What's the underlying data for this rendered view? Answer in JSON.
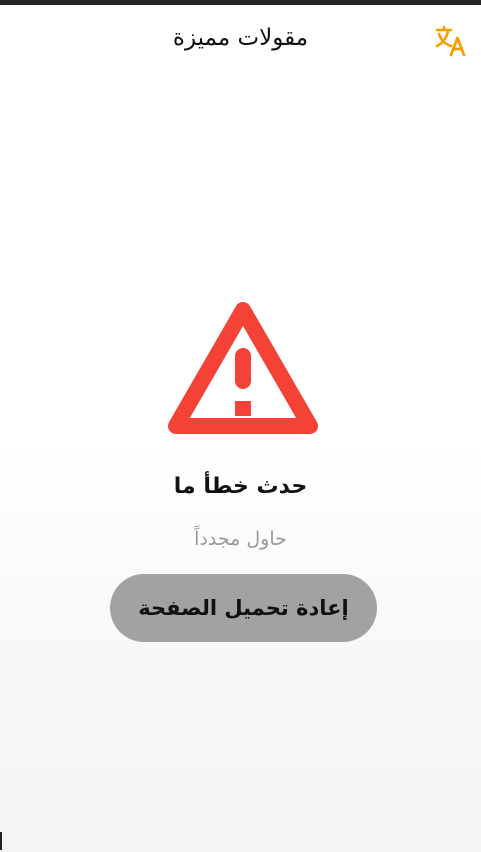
{
  "header": {
    "title": "مقولات مميزة",
    "translate_icon": "translate-icon",
    "accent_color": "#f5a000"
  },
  "error": {
    "icon": "warning-triangle-icon",
    "icon_color": "#f44336",
    "title": "حدث خطأ ما",
    "subtitle": "حاول مجدداً",
    "reload_label": "إعادة تحميل الصفحة"
  }
}
